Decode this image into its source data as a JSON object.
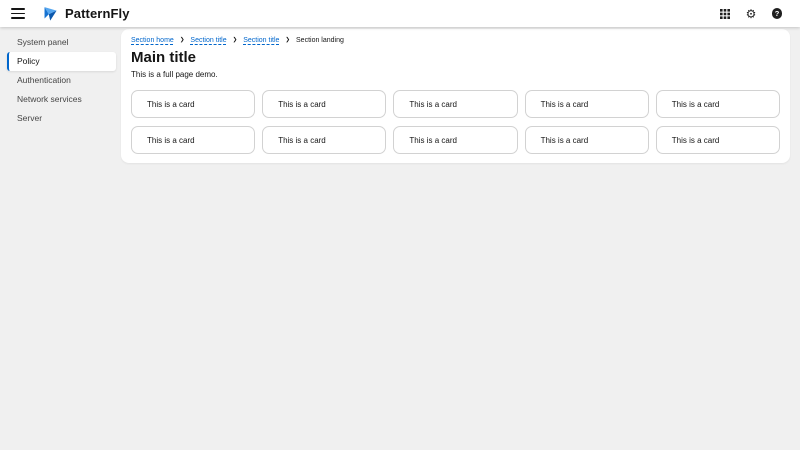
{
  "header": {
    "brand": "PatternFly",
    "colors": {
      "accent": "#0066cc",
      "background": "#ffffff"
    },
    "icons": [
      "hamburger-icon",
      "brand-logo-icon",
      "app-grid-icon",
      "settings-gear-icon",
      "help-icon"
    ],
    "help_glyph": "?"
  },
  "sidebar": {
    "items": [
      {
        "label": "System panel",
        "selected": false
      },
      {
        "label": "Policy",
        "selected": true
      },
      {
        "label": "Authentication",
        "selected": false
      },
      {
        "label": "Network services",
        "selected": false
      },
      {
        "label": "Server",
        "selected": false
      }
    ]
  },
  "breadcrumb": {
    "items": [
      {
        "label": "Section home",
        "current": false
      },
      {
        "label": "Section title",
        "current": false
      },
      {
        "label": "Section title",
        "current": false
      },
      {
        "label": "Section landing",
        "current": true
      }
    ],
    "separator": "❯"
  },
  "main": {
    "title": "Main title",
    "description": "This is a full page demo.",
    "cards": [
      "This is a card",
      "This is a card",
      "This is a card",
      "This is a card",
      "This is a card",
      "This is a card",
      "This is a card",
      "This is a card",
      "This is a card",
      "This is a card"
    ]
  }
}
